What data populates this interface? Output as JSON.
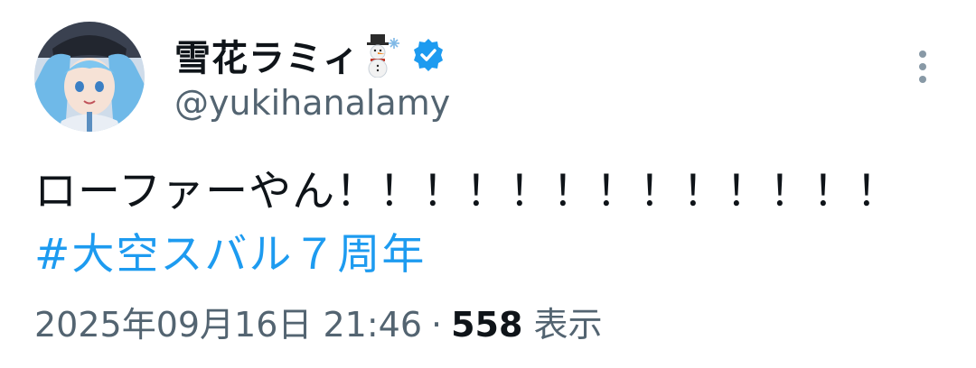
{
  "author": {
    "display_name": "雪花ラミィ",
    "name_emoji_icon": "snowman-with-snowflake-icon",
    "verified_icon": "verified-badge-icon",
    "handle": "@yukihanalamy",
    "avatar_icon": "avatar"
  },
  "menu": {
    "more_icon": "more-vertical-icon"
  },
  "tweet": {
    "text": "ローファーやん！！！！！！！！！！！！！",
    "hashtag": "#大空スバル７周年"
  },
  "meta": {
    "timestamp": "2025年09月16日 21:46",
    "separator": "·",
    "views_count": "558",
    "views_label": "表示"
  },
  "colors": {
    "text": "#0f1419",
    "secondary": "#536471",
    "link": "#1d9bf0",
    "verified": "#1d9bf0"
  }
}
